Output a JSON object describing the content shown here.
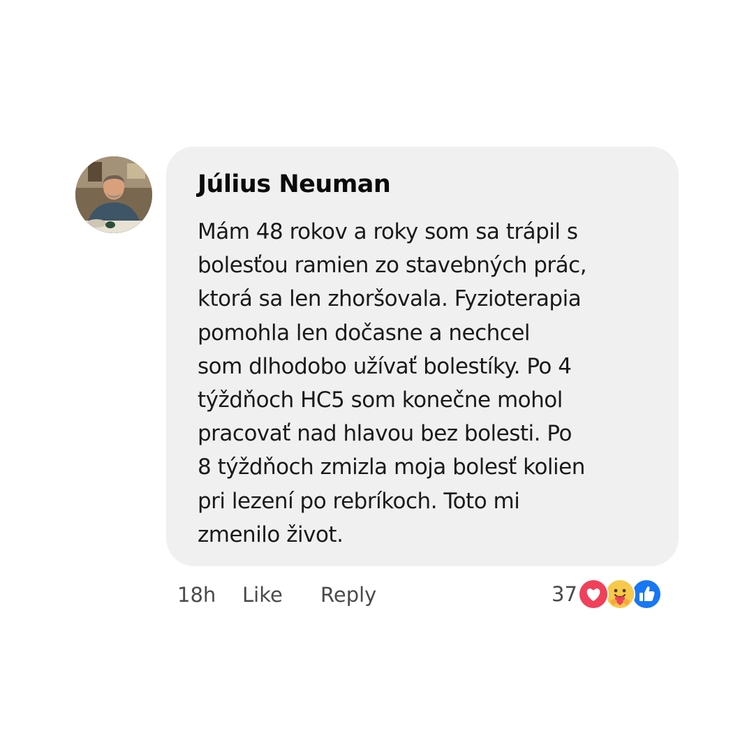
{
  "comment": {
    "author": "Július Neuman",
    "text_lines": [
      "Mám 48 rokov a roky som sa trápil s",
      "bolesťou ramien zo stavebných prác,",
      "ktorá sa len zhoršovala. Fyzioterapia",
      "pomohla len dočasne a nechcel",
      "som dlhodobo užívať bolestíky. Po 4",
      "týždňoch HC5 som konečne mohol",
      "pracovať nad hlavou bez bolesti. Po",
      "8 týždňoch zmizla moja bolesť kolien",
      "pri lezení po rebríkoch. Toto mi",
      "zmenilo život."
    ]
  },
  "actions": {
    "time": "18h",
    "like_label": "Like",
    "reply_label": "Reply"
  },
  "reactions": {
    "count": "37",
    "icons": [
      "heart-reaction-icon",
      "care-reaction-icon",
      "like-reaction-icon"
    ]
  },
  "colors": {
    "bubble_background": "#f0f0f0",
    "heart_red": "#f0405a",
    "like_blue": "#1877f2",
    "care_yellow": "#f7c94b",
    "meta_text": "#4a4a4a"
  }
}
